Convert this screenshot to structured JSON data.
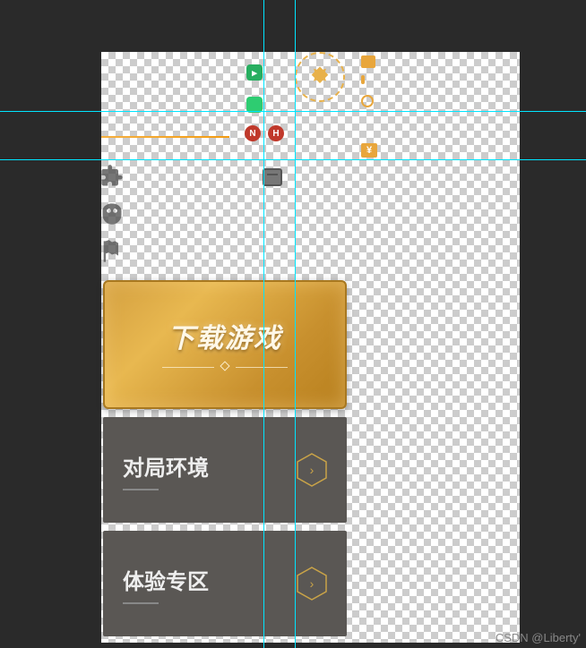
{
  "guides": {
    "h": [
      124,
      178
    ],
    "v": [
      294,
      329
    ]
  },
  "top_icons": {
    "play": "▸",
    "lock": "🔒",
    "badge_n": "N",
    "badge_h": "H",
    "yen": "¥"
  },
  "crest_name": "emblem-icon",
  "left_icons": [
    "puzzle-icon",
    "mask-icon",
    "flag-icon"
  ],
  "cards": {
    "download": {
      "label": "下载游戏"
    },
    "env": {
      "label": "对局环境"
    },
    "exp": {
      "label": "体验专区"
    }
  },
  "watermark": "CSDN @Liberty'"
}
